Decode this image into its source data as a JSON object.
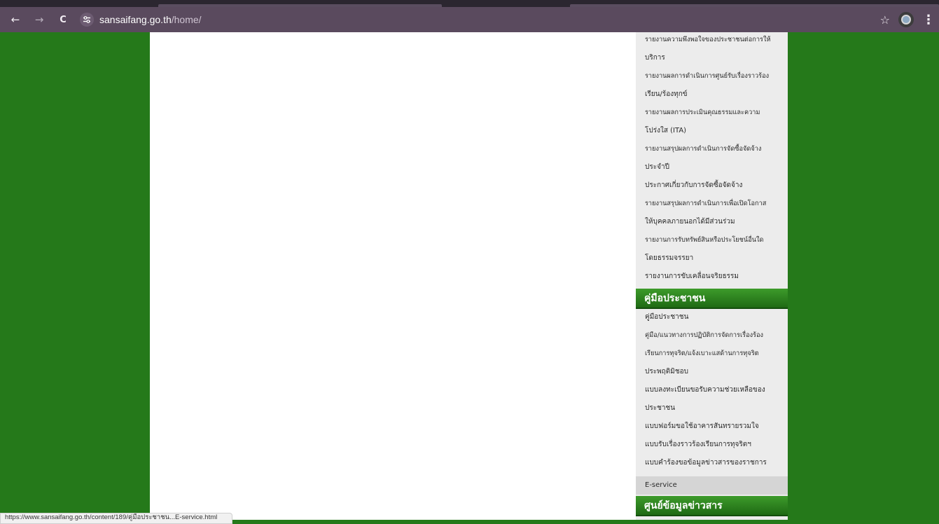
{
  "browser": {
    "url_host": "sansaifang.go.th",
    "url_path": "/home/",
    "back_icon": "←",
    "forward_icon": "→",
    "reload_icon": "C",
    "star_icon": "☆",
    "menu_icon": "⋮"
  },
  "sidebar": {
    "report_items": [
      "รายงานความพึงพอใจของประชาชนต่อการให้",
      "บริการ",
      "รายงานผลการดำเนินการศูนย์รับเรื่องราวร้อง",
      "เรียน/ร้องทุกข์",
      "รายงานผลการประเมินคุณธรรมและความ",
      "โปร่งใส (ITA)",
      "รายงานสรุปผลการดำเนินการจัดซื้อจัดจ้าง",
      "ประจำปี",
      "ประกาศเกี่ยวกับการจัดซื้อจัดจ้าง",
      "รายงานสรุปผลการดำเนินการเพื่อเปิดโอกาส",
      "ให้บุคคลภายนอกได้มีส่วนร่วม",
      "รายงานการรับทรัพย์สินหรือประโยชน์อื่นใด",
      "โดยธรรมจรรยา",
      "รายงานการขับเคลื่อนจริยธรรม"
    ],
    "manual_header": "คู่มือประชาชน",
    "manual_items": [
      "คู่มือประชาชน",
      "คู่มือ/แนวทางการปฏิบัติการจัดการเรื่องร้อง",
      "เรียนการทุจริต/แจ้งเบาะแสด้านการทุจริต",
      "ประพฤติมิชอบ",
      "แบบลงทะเบียนขอรับความช่วยเหลือของ",
      "ประชาชน",
      "แบบฟอร์มขอใช้อาคารสันทรายรวมใจ",
      "แบบรับเรื่องราวร้องเรียนการทุจริตฯ",
      "แบบคำร้องขอข้อมูลข่าวสารของราชการ",
      "E-service"
    ],
    "info_header": "ศูนย์ข้อมูลข่าวสาร"
  },
  "status_bar": {
    "text": "https://www.sansaifang.go.th/content/189/คู่มือประชาชน...E-service.html"
  },
  "colors": {
    "page_green": "#25791a",
    "header_green": "#2e8a20",
    "toolbar": "#5a4a5e"
  }
}
